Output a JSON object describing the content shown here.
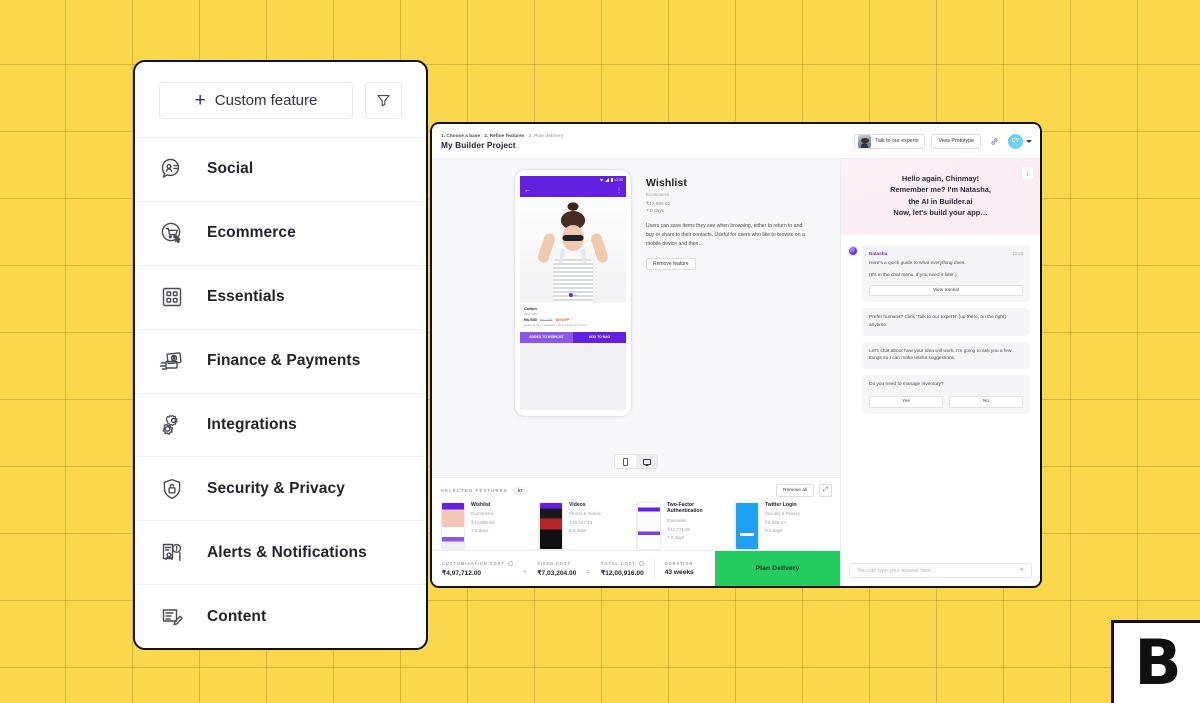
{
  "background": {
    "color": "#FBD84B",
    "grid_color": "#8a6c0e"
  },
  "logo": {
    "letter": "B",
    "name": "builder-ai-logo"
  },
  "category_card": {
    "custom_feature_label": "Custom feature",
    "filter_icon": "filter-funnel-icon",
    "items": [
      {
        "label": "Social",
        "icon": "social-chat-person-icon"
      },
      {
        "label": "Ecommerce",
        "icon": "shopping-cart-cursor-icon"
      },
      {
        "label": "Essentials",
        "icon": "grid-squares-icon"
      },
      {
        "label": "Finance & Payments",
        "icon": "money-bill-icon"
      },
      {
        "label": "Integrations",
        "icon": "gears-icon"
      },
      {
        "label": "Security & Privacy",
        "icon": "shield-lock-icon"
      },
      {
        "label": "Alerts & Notifications",
        "icon": "alert-person-icon"
      },
      {
        "label": "Content",
        "icon": "document-pencil-icon"
      }
    ]
  },
  "app": {
    "header": {
      "breadcrumbs": [
        {
          "text": "1. Choose a base",
          "state": "done"
        },
        {
          "text": "2. Refine features",
          "state": "done"
        },
        {
          "text": "3. Plan delivery",
          "state": "current"
        }
      ],
      "project_title": "My Builder Project",
      "talk_experts_label": "Talk to our experts",
      "view_prototype_label": "View Prototype",
      "link_icon": "link-chain-icon",
      "avatar_initials": "CY"
    },
    "phone_preview": {
      "status_time": "12:30",
      "product_title": "Cotton",
      "product_sub": "White Skirt",
      "price_current": "Rs.540",
      "price_original": "Rs.1,699",
      "discount": "64%OFF",
      "tax_note": "Additional GST, if applicable, will be charged at checkout",
      "cta_primary": "ADDED TO WISHLIST",
      "cta_secondary": "ADD TO BAG"
    },
    "device_toggle": {
      "mobile_icon": "mobile-device-icon",
      "desktop_icon": "desktop-device-icon",
      "selected": "desktop"
    },
    "detail": {
      "title": "Wishlist",
      "category": "Ecommerce",
      "price": "₹12,686.62",
      "duration": "7.0 days",
      "description": "Users can save items they see when browsing, either to return to and buy or share to their contacts. Useful for users who like to browse on a mobile device and then…",
      "remove_label": "Remove feature"
    },
    "selected_features": {
      "heading": "SELECTED FEATURES",
      "count": "67",
      "remove_all_label": "Remove all",
      "expand_icon": "expand-arrows-icon",
      "items": [
        {
          "name": "Wishlist",
          "category": "Ecommerce",
          "price": "₹12,686.62",
          "days": "7.0 days",
          "thumb": "th-a"
        },
        {
          "name": "Videos",
          "category": "Photos & Videos",
          "price": "₹16,247.13",
          "days": "6.0 days",
          "thumb": "th-b"
        },
        {
          "name": "Two-Factor Authentication",
          "category": "Essentials",
          "price": "₹12,771.81",
          "days": "7.0 days",
          "thumb": "th-c"
        },
        {
          "name": "Twitter Login",
          "category": "Security & Privacy",
          "price": "₹6,945.47",
          "days": "5.0 days",
          "thumb": "th-d"
        }
      ]
    },
    "cost_bar": {
      "customisation_label": "CUSTOMISATION COST",
      "customisation_value": "₹4,97,712.00",
      "operator_plus": "+",
      "fixed_label": "FIXED COST",
      "fixed_value": "₹7,03,204.00",
      "operator_equals": "=",
      "total_label": "TOTAL COST",
      "total_value": "₹12,00,916.00",
      "duration_label": "DURATION",
      "duration_value": "43 weeks",
      "plan_delivery_label": "Plan Delivery",
      "plan_delivery_color": "#23cc5e"
    },
    "chat": {
      "hero": [
        "Hello again, Chinmay!",
        "Remember me? I'm Natasha,",
        "the AI in Builder.ai",
        "Now, let's build your app…"
      ],
      "kebab_icon": "chat-menu-kebab-icon",
      "messages": [
        {
          "sender": "Natasha",
          "time": "13:55",
          "lines": [
            "Here's a quick guide to what everything does.",
            "(It's in the chat menu, if you need it later.)"
          ],
          "button": "View tutorial"
        },
        {
          "lines": [
            "Prefer humans? Click 'Talk to our experts' (up there, on the right) anytime."
          ]
        },
        {
          "lines": [
            "Let's chat about how your idea will work. I'm going to ask you a few things so I can make useful suggestions."
          ]
        },
        {
          "lines": [
            "Do you need to manage inventory?"
          ],
          "choices": [
            "Yes",
            "No"
          ]
        }
      ],
      "input_placeholder": "You can type your answer here…",
      "send_icon": "send-paper-plane-icon"
    }
  }
}
